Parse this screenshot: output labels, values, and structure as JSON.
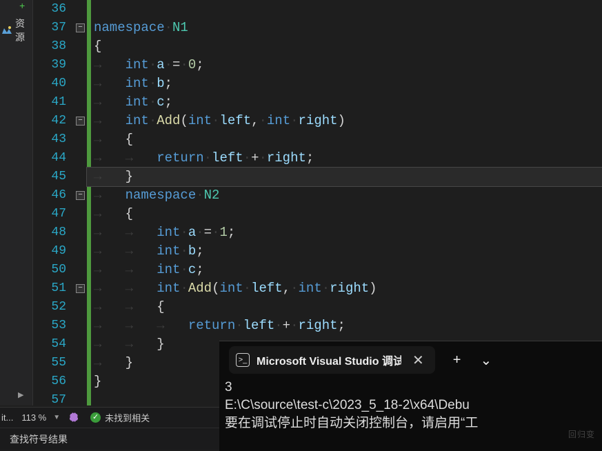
{
  "left_panel": {
    "resource_label": "资源",
    "plus_label": "+"
  },
  "editor": {
    "line_start": 36,
    "lines": [
      {
        "n": 36,
        "tokens": []
      },
      {
        "n": 37,
        "fold": "-",
        "tokens": [
          [
            "kw",
            "namespace"
          ],
          [
            "ws",
            " "
          ],
          [
            "cls",
            "N1"
          ]
        ]
      },
      {
        "n": 38,
        "tokens": [
          [
            "punct",
            "{"
          ]
        ]
      },
      {
        "n": 39,
        "tokens": [
          [
            "ws",
            "    "
          ],
          [
            "type",
            "int"
          ],
          [
            "ws",
            " "
          ],
          [
            "ident",
            "a"
          ],
          [
            "ws",
            " "
          ],
          [
            "op",
            "="
          ],
          [
            "ws",
            " "
          ],
          [
            "num",
            "0"
          ],
          [
            "punct",
            ";"
          ]
        ]
      },
      {
        "n": 40,
        "tokens": [
          [
            "ws",
            "    "
          ],
          [
            "type",
            "int"
          ],
          [
            "ws",
            " "
          ],
          [
            "ident",
            "b"
          ],
          [
            "punct",
            ";"
          ]
        ]
      },
      {
        "n": 41,
        "tokens": [
          [
            "ws",
            "    "
          ],
          [
            "type",
            "int"
          ],
          [
            "ws",
            " "
          ],
          [
            "ident",
            "c"
          ],
          [
            "punct",
            ";"
          ]
        ]
      },
      {
        "n": 42,
        "fold": "-",
        "tokens": [
          [
            "ws",
            "    "
          ],
          [
            "type",
            "int"
          ],
          [
            "ws",
            " "
          ],
          [
            "fn",
            "Add"
          ],
          [
            "punct",
            "("
          ],
          [
            "type",
            "int"
          ],
          [
            "ws",
            " "
          ],
          [
            "ident",
            "left"
          ],
          [
            "punct",
            ","
          ],
          [
            "ws",
            " "
          ],
          [
            "type",
            "int"
          ],
          [
            "ws",
            " "
          ],
          [
            "ident",
            "right"
          ],
          [
            "punct",
            ")"
          ]
        ]
      },
      {
        "n": 43,
        "tokens": [
          [
            "ws",
            "    "
          ],
          [
            "punct",
            "{"
          ]
        ]
      },
      {
        "n": 44,
        "tokens": [
          [
            "ws",
            "        "
          ],
          [
            "kw",
            "return"
          ],
          [
            "ws",
            " "
          ],
          [
            "ident",
            "left"
          ],
          [
            "ws",
            " "
          ],
          [
            "op",
            "+"
          ],
          [
            "ws",
            " "
          ],
          [
            "ident",
            "right"
          ],
          [
            "punct",
            ";"
          ]
        ]
      },
      {
        "n": 45,
        "hl": true,
        "tokens": [
          [
            "ws",
            "    "
          ],
          [
            "punct",
            "}"
          ]
        ]
      },
      {
        "n": 46,
        "fold": "-",
        "tokens": [
          [
            "ws",
            "    "
          ],
          [
            "kw",
            "namespace"
          ],
          [
            "ws",
            " "
          ],
          [
            "cls",
            "N2"
          ]
        ]
      },
      {
        "n": 47,
        "tokens": [
          [
            "ws",
            "    "
          ],
          [
            "punct",
            "{"
          ]
        ]
      },
      {
        "n": 48,
        "tokens": [
          [
            "ws",
            "        "
          ],
          [
            "type",
            "int"
          ],
          [
            "ws",
            " "
          ],
          [
            "ident",
            "a"
          ],
          [
            "ws",
            " "
          ],
          [
            "op",
            "="
          ],
          [
            "ws",
            " "
          ],
          [
            "num",
            "1"
          ],
          [
            "punct",
            ";"
          ]
        ]
      },
      {
        "n": 49,
        "tokens": [
          [
            "ws",
            "        "
          ],
          [
            "type",
            "int"
          ],
          [
            "ws",
            " "
          ],
          [
            "ident",
            "b"
          ],
          [
            "punct",
            ";"
          ]
        ]
      },
      {
        "n": 50,
        "tokens": [
          [
            "ws",
            "        "
          ],
          [
            "type",
            "int"
          ],
          [
            "ws",
            " "
          ],
          [
            "ident",
            "c"
          ],
          [
            "punct",
            ";"
          ]
        ]
      },
      {
        "n": 51,
        "fold": "-",
        "tokens": [
          [
            "ws",
            "        "
          ],
          [
            "type",
            "int"
          ],
          [
            "ws",
            " "
          ],
          [
            "fn",
            "Add"
          ],
          [
            "punct",
            "("
          ],
          [
            "type",
            "int"
          ],
          [
            "ws",
            " "
          ],
          [
            "ident",
            "left"
          ],
          [
            "punct",
            ","
          ],
          [
            "ws",
            " "
          ],
          [
            "type",
            "int"
          ],
          [
            "ws",
            " "
          ],
          [
            "ident",
            "right"
          ],
          [
            "punct",
            ")"
          ]
        ]
      },
      {
        "n": 52,
        "tokens": [
          [
            "ws",
            "        "
          ],
          [
            "punct",
            "{"
          ]
        ]
      },
      {
        "n": 53,
        "tokens": [
          [
            "ws",
            "            "
          ],
          [
            "kw",
            "return"
          ],
          [
            "ws",
            " "
          ],
          [
            "ident",
            "left"
          ],
          [
            "ws",
            " "
          ],
          [
            "op",
            "+"
          ],
          [
            "ws",
            " "
          ],
          [
            "ident",
            "right"
          ],
          [
            "punct",
            ";"
          ]
        ]
      },
      {
        "n": 54,
        "tokens": [
          [
            "ws",
            "        "
          ],
          [
            "punct",
            "}"
          ]
        ]
      },
      {
        "n": 55,
        "tokens": [
          [
            "ws",
            "    "
          ],
          [
            "punct",
            "}"
          ]
        ]
      },
      {
        "n": 56,
        "tokens": [
          [
            "punct",
            "}"
          ]
        ]
      },
      {
        "n": 57,
        "tokens": []
      }
    ]
  },
  "status": {
    "it": "it...",
    "zoom": "113 %",
    "issues_text": "未找到相关"
  },
  "bottom_tabs": {
    "find_results": "查找符号结果"
  },
  "terminal": {
    "tab_title": "Microsoft Visual Studio 调试控",
    "plus": "+",
    "chevron": "⌄",
    "close": "✕",
    "output": [
      "3",
      "E:\\C\\source\\test-c\\2023_5_18-2\\x64\\Debu",
      "要在调试停止时自动关闭控制台，请启用“工"
    ]
  },
  "watermark": "回归变"
}
